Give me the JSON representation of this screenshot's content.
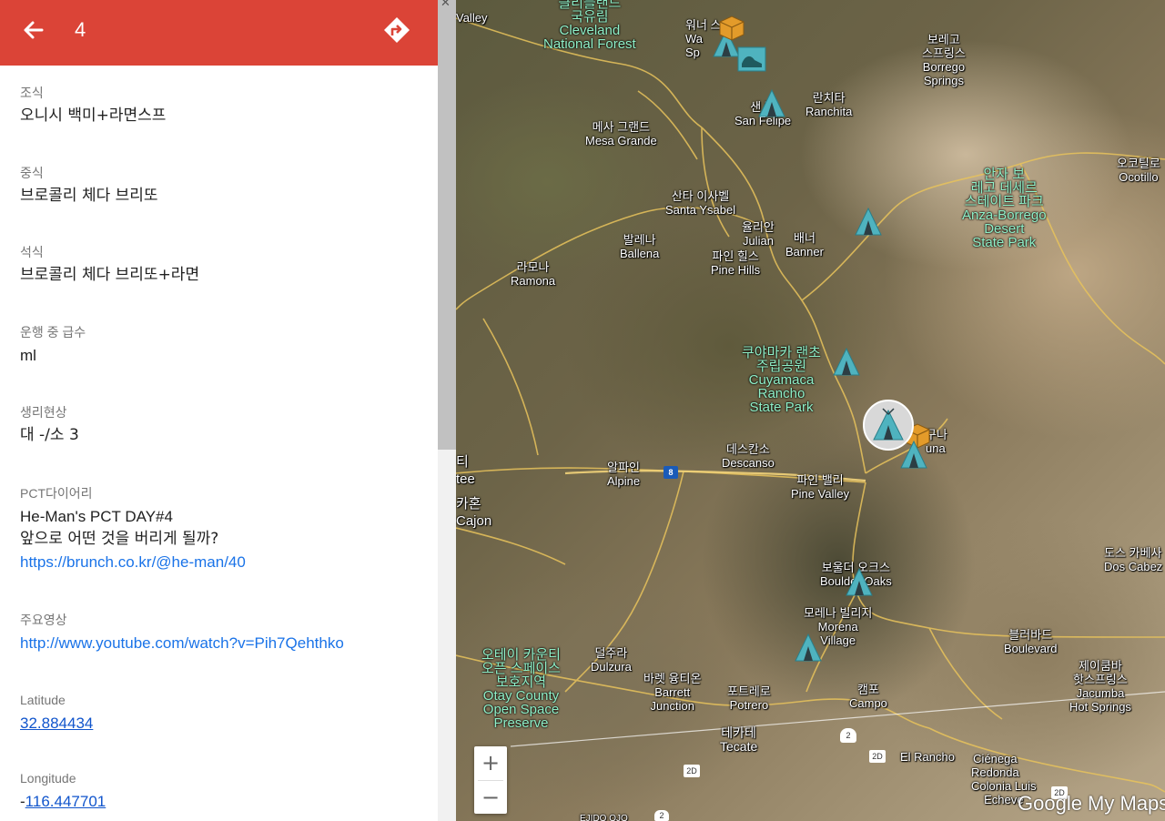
{
  "header": {
    "title": "4",
    "color": "#db4437",
    "back_icon": "arrow-left-icon",
    "directions_icon": "directions-icon"
  },
  "fields": {
    "breakfast": {
      "label": "조식",
      "value": "오니시 백미+라면스프"
    },
    "lunch": {
      "label": "중식",
      "value": "브로콜리 체다 브리또"
    },
    "dinner": {
      "label": "석식",
      "value": "브로콜리 체다 브리또+라면"
    },
    "water": {
      "label": "운행 중 급수",
      "value": "ml"
    },
    "bowel": {
      "label": "생리현상",
      "value": "대 -/소 3"
    },
    "diary": {
      "label": "PCT다이어리",
      "line1": "He-Man's PCT DAY#4",
      "line2": "앞으로 어떤 것을 버리게 될까?",
      "link": "https://brunch.co.kr/@he-man/40"
    },
    "video": {
      "label": "주요영상",
      "link": "http://www.youtube.com/watch?v=Pih7Qehthko"
    },
    "latitude": {
      "label": "Latitude",
      "value": "32.884434"
    },
    "longitude": {
      "label": "Longitude",
      "prefix": "-",
      "value": "116.447701"
    }
  },
  "map": {
    "places": {
      "valley": "Valley",
      "cleveland_ko1": "클리블랜드",
      "cleveland_ko2": "국유림",
      "cleveland_en1": "Cleveland",
      "cleveland_en2": "National Forest",
      "warner_ko": "워너 스",
      "warner_en1": "Wa",
      "warner_en2": "Sp",
      "borrego_ko1": "보레고",
      "borrego_ko2": "스프링스",
      "borrego_en1": "Borrego",
      "borrego_en2": "Springs",
      "sanfelipe_ko": "샌 펠",
      "sanfelipe_en": "San Felipe",
      "ranchita_ko": "란치타",
      "ranchita_en": "Ranchita",
      "mesagrande_ko": "메사 그랜드",
      "mesagrande_en": "Mesa Grande",
      "ocotillo_ko": "오코틸로",
      "ocotillo_en": "Ocotillo",
      "anza_ko1": "안자 보",
      "anza_ko2": "레고 데세르",
      "anza_ko3": "스테이트 파크",
      "anza_en1": "Anza-Borrego",
      "anza_en2": "Desert",
      "anza_en3": "State Park",
      "santaysabel_ko": "산타 이사벨",
      "santaysabel_en": "Santa Ysabel",
      "julian_ko": "율리안",
      "julian_en": "Julian",
      "banner_ko": "배너",
      "banner_en": "Banner",
      "ballena_ko": "발레나",
      "ballena_en": "Ballena",
      "pinehills_ko": "파인 힐스",
      "pinehills_en": "Pine Hills",
      "ramona_ko": "라모나",
      "ramona_en": "Ramona",
      "cuyamaca_ko1": "쿠야마카 랜초",
      "cuyamaca_ko2": "주립공원",
      "cuyamaca_en1": "Cuyamaca",
      "cuyamaca_en2": "Rancho",
      "cuyamaca_en3": "State Park",
      "laguna_ko": "구나",
      "laguna_en": "una",
      "descanso_ko": "데스칸소",
      "descanso_en": "Descanso",
      "alpine_ko": "알파인",
      "alpine_en": "Alpine",
      "pinevalley_ko": "파인 밸리",
      "pinevalley_en": "Pine Valley",
      "santee_ko": "티",
      "santee_en": "tee",
      "cajon_ko": "카혼",
      "cajon_en": "Cajon",
      "dos_ko": "도스 카베사",
      "dos_en": "Dos Cabez",
      "boulder_ko": "보울더 오크스",
      "boulder_en": "Boulder Oaks",
      "morena_ko": "모레나 빌리지",
      "morena_en1": "Morena",
      "morena_en2": "Village",
      "otay_ko1": "오테이 카운티",
      "otay_ko2": "오픈 스페이스",
      "otay_ko3": "보호지역",
      "otay_en1": "Otay County",
      "otay_en2": "Open Space",
      "otay_en3": "Preserve",
      "dulzura_ko": "덜주라",
      "dulzura_en": "Dulzura",
      "barrett_ko": "바렛 융티온",
      "barrett_en1": "Barrett",
      "barrett_en2": "Junction",
      "potrero_ko": "포트레로",
      "potrero_en": "Potrero",
      "campo_ko": "캠포",
      "campo_en": "Campo",
      "boulevard_ko": "블러바드",
      "boulevard_en": "Boulevard",
      "jacumba_ko1": "제이쿰바",
      "jacumba_ko2": "핫스프링스",
      "jacumba_en1": "Jacumba",
      "jacumba_en2": "Hot Springs",
      "tecate_ko": "테카테",
      "tecate_en": "Tecate",
      "elrancho": "El Rancho",
      "cienega1": "Ciénega",
      "cienega2": "Redonda",
      "colonia1": "Colonia Luis",
      "colonia2": "Echeve",
      "ejido": "EJIDO OJO"
    },
    "highways": {
      "i8": "8",
      "h2a": "2",
      "h2d1": "2D",
      "h2d2": "2D",
      "h2d3": "2D",
      "h2b": "2"
    },
    "zoom_in": "+",
    "zoom_out": "−",
    "logo": "Google My Maps",
    "marker_color": "#4fb3bf"
  }
}
